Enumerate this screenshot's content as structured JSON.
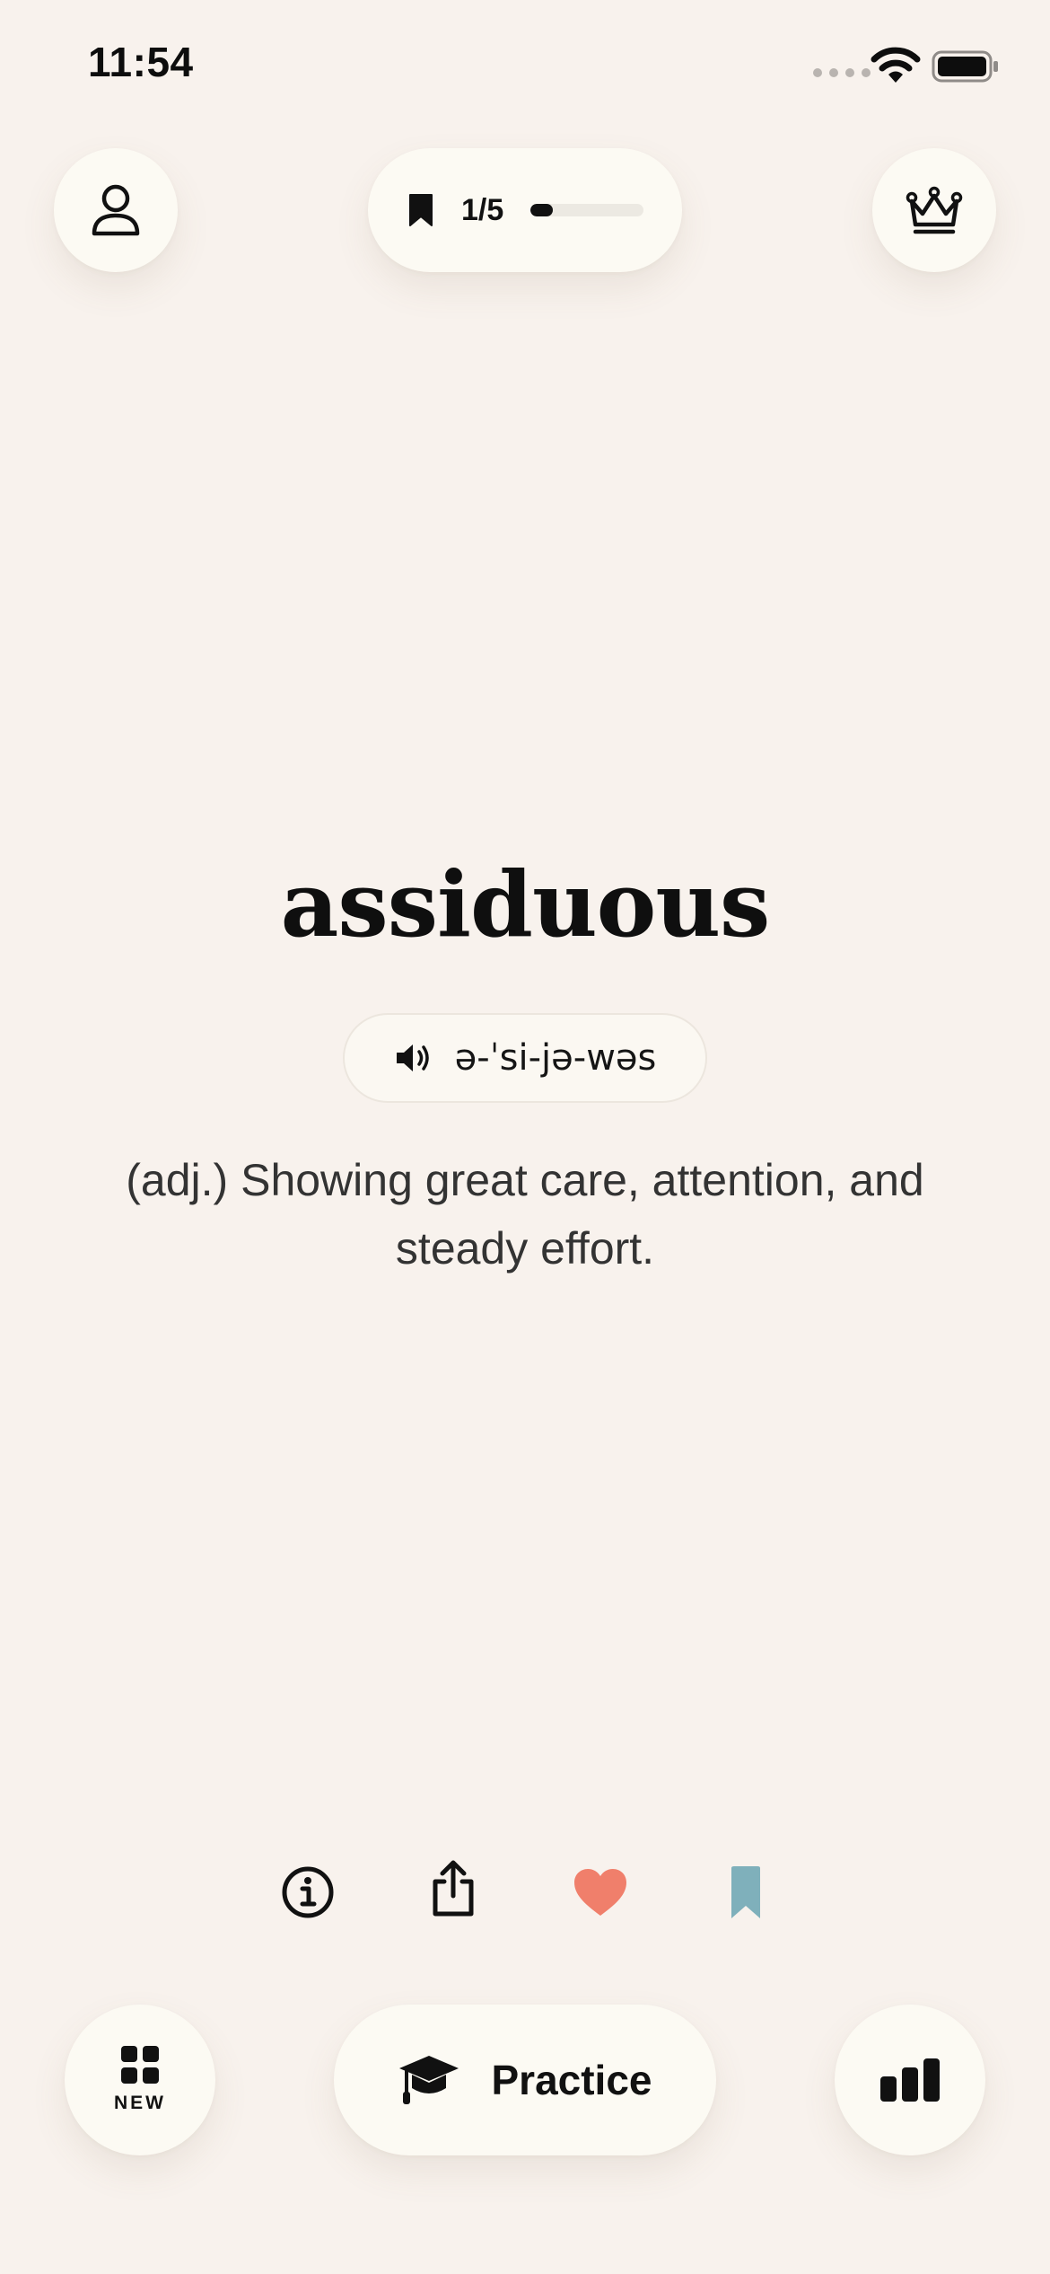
{
  "status_bar": {
    "time": "11:54"
  },
  "header": {
    "progress": {
      "label": "1/5",
      "current": 1,
      "total": 5,
      "fraction": 0.2
    },
    "profile_icon": "person-icon",
    "premium_icon": "crown-icon"
  },
  "word_card": {
    "word": "assiduous",
    "pronunciation": "ə-ˈsi-jə-wəs",
    "definition": "(adj.) Showing great care, attention, and steady effort."
  },
  "actions": {
    "icons": [
      "info-icon",
      "share-icon",
      "heart-icon",
      "bookmark-icon"
    ],
    "heart_color": "#f07f6b",
    "bookmark_color": "#7fb0bb"
  },
  "bottom_bar": {
    "new_label": "NEW",
    "practice_label": "Practice",
    "stats_icon": "bar-chart-icon"
  },
  "colors": {
    "background": "#f8f2ed",
    "surface": "#fcfaf3",
    "text": "#111111"
  }
}
